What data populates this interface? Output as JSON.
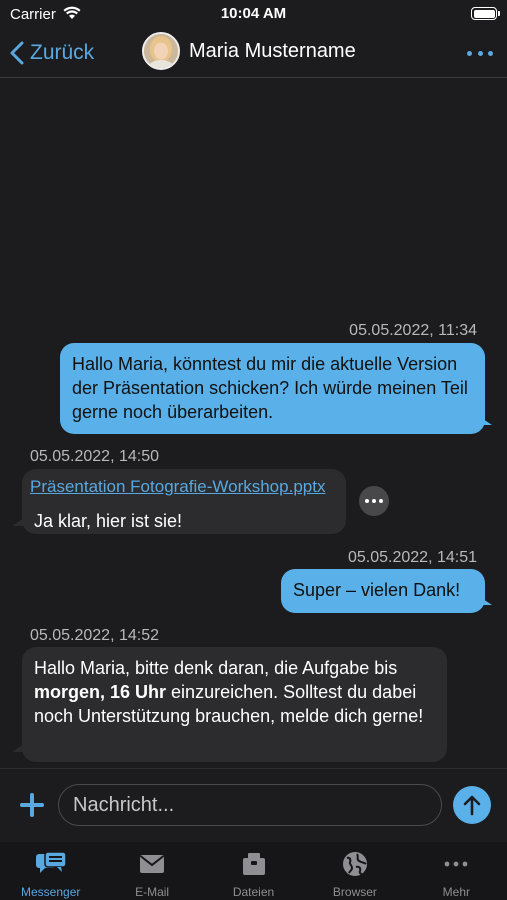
{
  "status_bar": {
    "carrier": "Carrier",
    "time": "10:04 AM"
  },
  "nav": {
    "back_label": "Zurück",
    "contact_name": "Maria Mustername"
  },
  "messages": [
    {
      "direction": "outgoing",
      "timestamp": "05.05.2022, 11:34",
      "text": "Hallo Maria, könntest du mir die aktuelle Version der Präsentation schicken? Ich würde meinen Teil gerne noch überarbeiten."
    },
    {
      "direction": "incoming",
      "timestamp": "05.05.2022, 14:50",
      "attachment": "Präsentation Fotografie-Workshop.pptx",
      "text": "Ja klar, hier ist sie!"
    },
    {
      "direction": "outgoing",
      "timestamp": "05.05.2022, 14:51",
      "text": "Super – vielen Dank!"
    },
    {
      "direction": "incoming",
      "timestamp": "05.05.2022, 14:52",
      "text_before": "Hallo Maria, bitte denk daran, die Aufgabe bis",
      "text_bold": "morgen, 16 Uhr",
      "text_after": " einzureichen. Solltest du dabei noch Unterstützung brauchen, melde dich gerne!"
    }
  ],
  "composer": {
    "placeholder": "Nachricht..."
  },
  "tabs": [
    {
      "label": "Messenger",
      "icon": "messenger-icon",
      "active": true
    },
    {
      "label": "E-Mail",
      "icon": "mail-icon",
      "active": false
    },
    {
      "label": "Dateien",
      "icon": "files-icon",
      "active": false
    },
    {
      "label": "Browser",
      "icon": "globe-icon",
      "active": false
    },
    {
      "label": "Mehr",
      "icon": "more-icon",
      "active": false
    }
  ],
  "colors": {
    "accent": "#5aa8e0",
    "outgoing_bubble": "#5ab0e8",
    "incoming_bubble": "#2c2c2e",
    "background": "#1c1c1e"
  }
}
